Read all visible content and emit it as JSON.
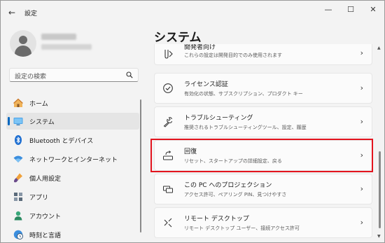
{
  "window": {
    "title": "設定",
    "back_glyph": "←",
    "minimize_glyph": "—",
    "maximize_glyph": "☐",
    "close_glyph": "✕"
  },
  "user": {
    "avatar_icon": "person-icon"
  },
  "search": {
    "placeholder": "設定の検索",
    "icon": "search-icon"
  },
  "nav": {
    "items": [
      {
        "label": "ホーム",
        "icon": "home-icon",
        "active": false
      },
      {
        "label": "システム",
        "icon": "display-icon",
        "active": true
      },
      {
        "label": "Bluetooth とデバイス",
        "icon": "bluetooth-icon",
        "active": false
      },
      {
        "label": "ネットワークとインターネット",
        "icon": "wifi-icon",
        "active": false
      },
      {
        "label": "個人用設定",
        "icon": "brush-icon",
        "active": false
      },
      {
        "label": "アプリ",
        "icon": "apps-icon",
        "active": false
      },
      {
        "label": "アカウント",
        "icon": "account-icon",
        "active": false
      },
      {
        "label": "時刻と言語",
        "icon": "clock-globe-icon",
        "active": false
      }
    ]
  },
  "main": {
    "title": "システム",
    "cards": [
      {
        "title": "開発者向け",
        "desc": "これらの設定は開発目的でのみ使用されます",
        "icon": "developer-icon"
      },
      {
        "title": "ライセンス認証",
        "desc": "有効化の状態、サブスクリプション、プロダクト キー",
        "icon": "activation-check-icon"
      },
      {
        "title": "トラブルシューティング",
        "desc": "推奨されるトラブルシューティングツール、設定、履歴",
        "icon": "wrench-icon"
      },
      {
        "title": "回復",
        "desc": "リセット、スタートアップの詳細設定、戻る",
        "icon": "recovery-icon"
      },
      {
        "title": "この PC へのプロジェクション",
        "desc": "アクセス許可、ペアリング PIN、見つけやすさ",
        "icon": "projection-icon"
      },
      {
        "title": "リモート デスクトップ",
        "desc": "リモート デスクトップ ユーザー、接続アクセス許可",
        "icon": "remote-desktop-icon"
      }
    ],
    "chevron_glyph": "›"
  },
  "colors": {
    "accent": "#0067c0",
    "highlight": "#e3141e"
  }
}
